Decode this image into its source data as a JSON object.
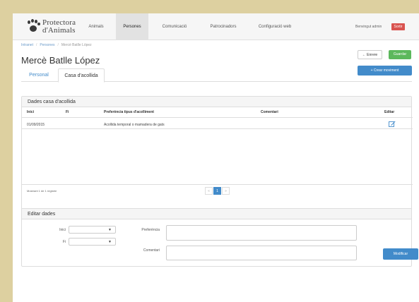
{
  "brand": {
    "line1": "Protectora",
    "line2": "d'Animals"
  },
  "nav": {
    "items": [
      {
        "label": "Animals"
      },
      {
        "label": "Persones"
      },
      {
        "label": "Comunicació"
      },
      {
        "label": "Patrocinadors"
      },
      {
        "label": "Configuració web"
      }
    ],
    "active": "Persones",
    "welcome": "Benvingut admin",
    "logout": "Sortir"
  },
  "breadcrumb": [
    "Intranet",
    "Persones",
    "Mercè Batlle López"
  ],
  "page_title": "Mercè Batlle López",
  "buttons": {
    "back": "← Enrere",
    "save": "Guardar",
    "new_movement": "+ Crear moviment",
    "modify": "Modificar"
  },
  "tabs": [
    "Personal",
    "Casa d'acollida"
  ],
  "active_tab": "Casa d'acollida",
  "table_panel": {
    "title": "Dades casa d'acollida",
    "columns": [
      "Inici",
      "Fi",
      "Preferència tipus d'acolliment",
      "Comentari",
      "Editar"
    ],
    "rows": [
      {
        "inici": "01/09/2015",
        "fi": "",
        "preferencia": "Acollida temporal o mamadera de gats",
        "comentari": ""
      }
    ],
    "info": "Mostrant 1 de 1 registre",
    "pagination": {
      "prev": "«",
      "current": "1",
      "next": "»"
    }
  },
  "edit_panel": {
    "title": "Editar dades",
    "labels": {
      "inici": "Inici",
      "fi": "Fi",
      "preferencia": "Preferència",
      "comentari": "Comentari"
    },
    "values": {
      "inici": "",
      "fi": "",
      "preferencia": "",
      "comentari": ""
    }
  },
  "colors": {
    "primary": "#428bca",
    "success": "#5cb85c",
    "danger": "#d9534f",
    "frame": "#ddd0a0"
  },
  "icons": {
    "brand": "paw-icon",
    "edit": "edit-icon",
    "back": "arrow-left-icon",
    "new": "plus-icon",
    "dropdown": "caret-down-icon"
  }
}
